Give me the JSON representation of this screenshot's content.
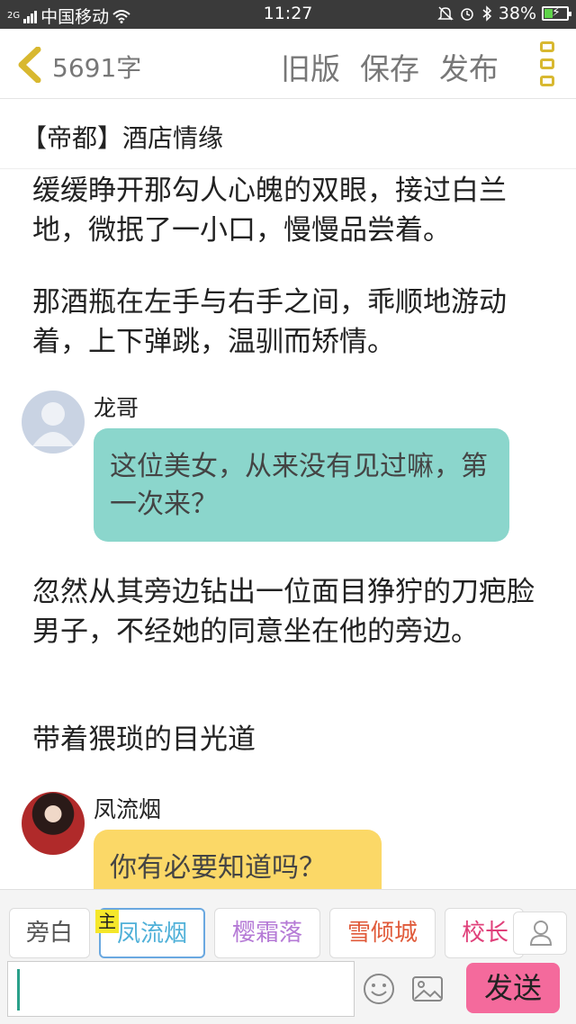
{
  "status_bar": {
    "network": "中国移动",
    "network_type": "2G",
    "time": "11:27",
    "battery_percent": "38%",
    "battery_level": 0.38
  },
  "header": {
    "word_count": "5691字",
    "old_version_label": "旧版",
    "save_label": "保存",
    "publish_label": "发布"
  },
  "story": {
    "title": "【帝都】酒店情缘"
  },
  "content": {
    "p1": "缓缓睁开那勾人心魄的双眼，接过白兰地，微抿了一小口，慢慢品尝着。",
    "p2": "那酒瓶在左手与右手之间，乖顺地游动着，上下弹跳，温驯而矫情。",
    "dialog1": {
      "speaker": "龙哥",
      "text": "这位美女，从来没有见过嘛，第一次来？"
    },
    "p3": "忽然从其旁边钻出一位面目狰狞的刀疤脸男子，不经她的同意坐在他的旁边。",
    "p4": "带着猥琐的目光道",
    "dialog2": {
      "speaker": "凤流烟",
      "text": "你有必要知道吗？"
    }
  },
  "characters": {
    "items": [
      {
        "label": "旁白",
        "color": "#555555"
      },
      {
        "label": "凤流烟",
        "color": "#4fb0d8"
      },
      {
        "label": "樱霜落",
        "color": "#b57ad6"
      },
      {
        "label": "雪倾城",
        "color": "#e05a3a"
      },
      {
        "label": "校长",
        "color": "#e0407a"
      }
    ],
    "main_tag": "主",
    "selected_index": 1
  },
  "composer": {
    "send_label": "发送"
  },
  "colors": {
    "accent_yellow": "#d8b830",
    "bubble_teal": "#8bd6cc",
    "bubble_yellow": "#fbd867",
    "send_pink": "#f46a9c"
  }
}
